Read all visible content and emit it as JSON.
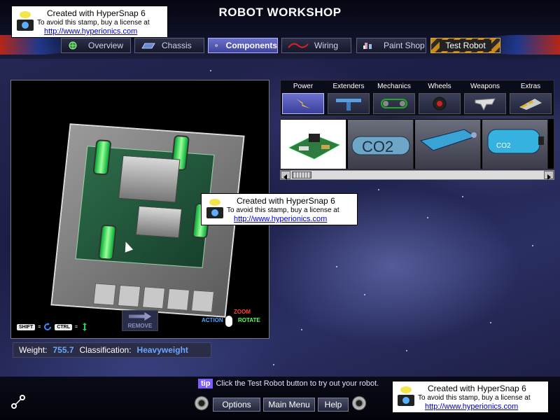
{
  "app": {
    "title": "ROBOT WORKSHOP"
  },
  "nav": {
    "tabs": [
      {
        "label": "Overview",
        "icon": "globe-icon",
        "active": false
      },
      {
        "label": "Chassis",
        "icon": "chassis-icon",
        "active": false
      },
      {
        "label": "Components",
        "icon": "gear-icon",
        "active": true
      },
      {
        "label": "Wiring",
        "icon": "wire-icon",
        "active": false
      },
      {
        "label": "Paint Shop",
        "icon": "paint-icon",
        "active": false
      },
      {
        "label": "Test Robot",
        "icon": "",
        "active": false
      }
    ]
  },
  "viewport": {
    "hints": {
      "shift_key": "SHIFT",
      "ctrl_key": "CTRL",
      "equals": "=",
      "remove_label": "REMOVE",
      "zoom_label": "ZOOM",
      "action_label": "ACTION",
      "rotate_label": "ROTATE"
    }
  },
  "stats": {
    "weight_label": "Weight:",
    "weight_value": "755.7",
    "class_label": "Classification:",
    "class_value": "Heavyweight"
  },
  "parts": {
    "categories": [
      {
        "label": "Power",
        "icon": "lightning-icon",
        "active": true
      },
      {
        "label": "Extenders",
        "icon": "extender-icon",
        "active": false
      },
      {
        "label": "Mechanics",
        "icon": "chain-icon",
        "active": false
      },
      {
        "label": "Wheels",
        "icon": "wheel-icon",
        "active": false
      },
      {
        "label": "Weapons",
        "icon": "blade-icon",
        "active": false
      },
      {
        "label": "Extras",
        "icon": "hazard-icon",
        "active": false
      }
    ],
    "items": [
      {
        "icon": "circuit-board-icon",
        "selected": true,
        "text": ""
      },
      {
        "icon": "co2-canister-icon",
        "selected": false,
        "text": "CO2"
      },
      {
        "icon": "tank-icon",
        "selected": false,
        "text": ""
      },
      {
        "icon": "co2-tank-icon",
        "selected": false,
        "text": "CO2"
      }
    ]
  },
  "footer": {
    "tip_badge": "tip",
    "tip_text": "Click the Test Robot button to try out your robot.",
    "options_label": "Options",
    "main_menu_label": "Main Menu",
    "help_label": "Help"
  },
  "watermark": {
    "line1": "Created with HyperSnap 6",
    "line2": "To avoid this stamp, buy a license at",
    "line3": "http://www.hyperionics.com"
  },
  "colors": {
    "active_tab": "#5a60c0",
    "weight_value": "#6aa8ff",
    "tip_badge": "#7a5cff"
  }
}
